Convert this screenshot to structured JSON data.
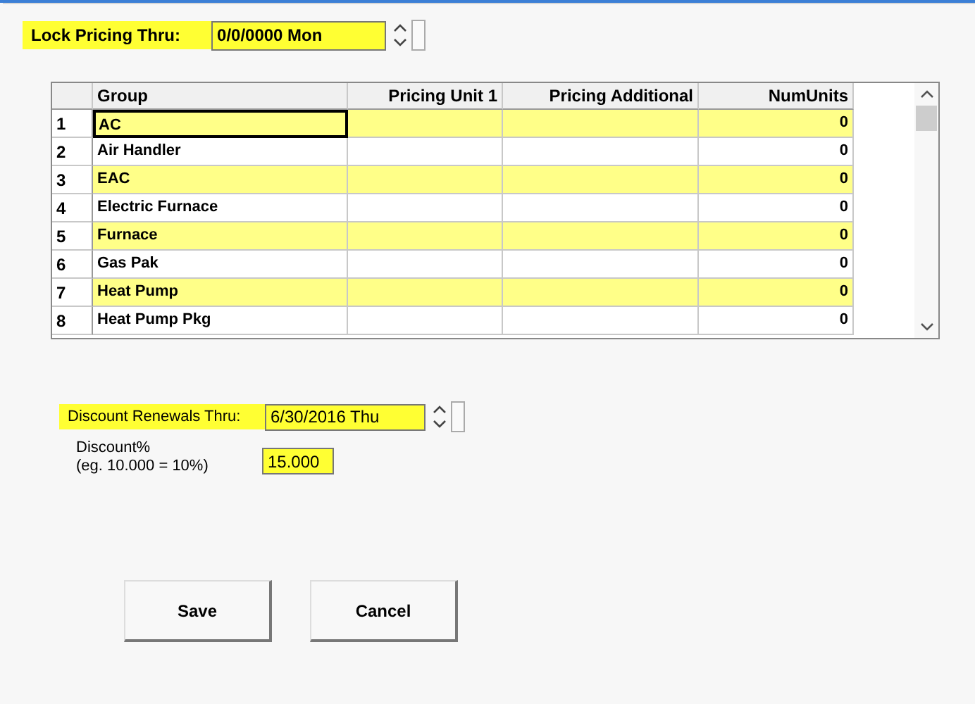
{
  "lock_pricing": {
    "label": "Lock Pricing Thru:",
    "value": "0/0/0000 Mon",
    "highlighted": true
  },
  "grid": {
    "columns": [
      "Group",
      "Pricing Unit 1",
      "Pricing Additional",
      "NumUnits"
    ],
    "rows": [
      {
        "number": "1",
        "group": "AC",
        "pricing_unit_1": "",
        "pricing_additional": "",
        "num_units": "0",
        "shaded": true,
        "selected": true
      },
      {
        "number": "2",
        "group": "Air Handler",
        "num_units": "0",
        "shaded": false,
        "selected": false
      },
      {
        "number": "3",
        "group": "EAC",
        "num_units": "0",
        "shaded": true,
        "selected": false
      },
      {
        "number": "4",
        "group": "Electric Furnace",
        "num_units": "0",
        "shaded": false,
        "selected": false
      },
      {
        "number": "5",
        "group": "Furnace",
        "num_units": "0",
        "shaded": true,
        "selected": false
      },
      {
        "number": "6",
        "group": "Gas Pak",
        "num_units": "0",
        "shaded": false,
        "selected": false
      },
      {
        "number": "7",
        "group": "Heat Pump",
        "num_units": "0",
        "shaded": true,
        "selected": false
      },
      {
        "number": "8",
        "group": "Heat Pump Pkg",
        "num_units": "0",
        "shaded": false,
        "selected": false
      }
    ]
  },
  "discount_renewals": {
    "label": "Discount Renewals Thru:",
    "value": "6/30/2016 Thu",
    "highlighted": true
  },
  "discount": {
    "label": "Discount%",
    "hint": "(eg. 10.000 = 10%)",
    "value": "15.000",
    "highlighted": true
  },
  "buttons": [
    "Save",
    "Cancel"
  ]
}
